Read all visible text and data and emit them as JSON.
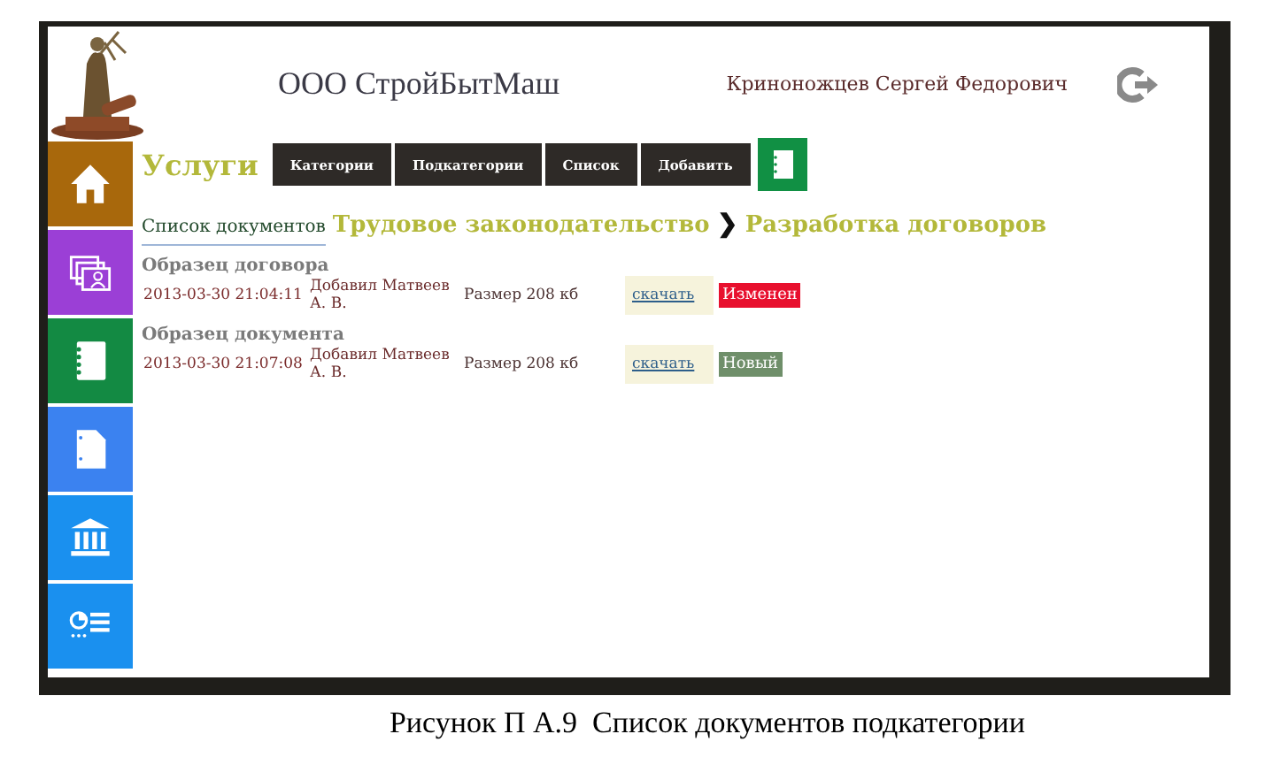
{
  "header": {
    "company": "ООО СтройБытМаш",
    "user": "Криноножцев Сергей Федорович"
  },
  "sidebar": {
    "items": [
      {
        "color": "#a8680c"
      },
      {
        "color": "#9b3fd6"
      },
      {
        "color": "#138a43"
      },
      {
        "color": "#3b82f0"
      },
      {
        "color": "#1a90ef"
      },
      {
        "color": "#1a90ef"
      }
    ]
  },
  "section": {
    "title": "Услуги",
    "buttons": [
      "Категории",
      "Подкатегории",
      "Список",
      "Добавить"
    ]
  },
  "breadcrumb": {
    "link": "Список документов",
    "items": [
      "Трудовое законодательство",
      "Разработка договоров"
    ],
    "separator": "❯"
  },
  "documents": [
    {
      "title": "Образец договора",
      "date": "2013-03-30 21:04:11",
      "added_by": "Добавил Матвеев А. В.",
      "size": "Размер 208 кб",
      "download": "скачать",
      "status": "Изменен",
      "color": "#e8102e"
    },
    {
      "title": "Образец документа",
      "date": "2013-03-30 21:07:08",
      "added_by": "Добавил Матвеев А. В.",
      "size": "Размер 208 кб",
      "download": "скачать",
      "status": "Новый",
      "color": "#6f8f6a"
    }
  ],
  "caption": "Рисунок П А.9  Список документов подкатегории"
}
